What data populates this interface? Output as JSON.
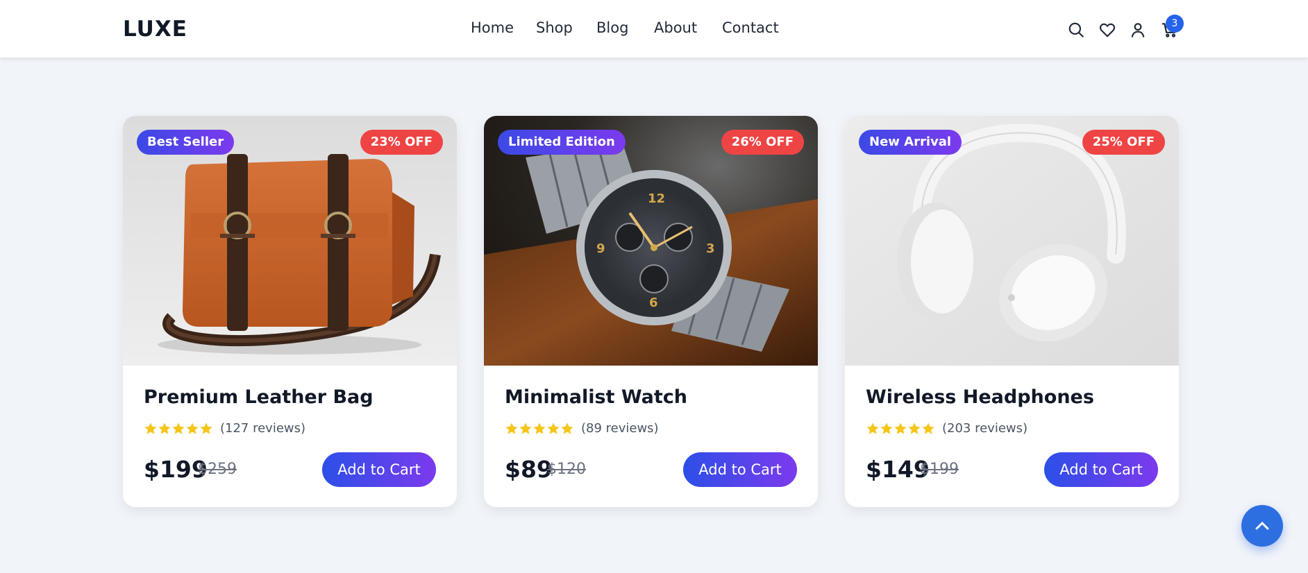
{
  "header": {
    "logo": "LUXE",
    "nav": [
      "Home",
      "Shop",
      "Blog",
      "About",
      "Contact"
    ],
    "cart_count": "3",
    "icons": [
      "search-icon",
      "heart-icon",
      "user-icon",
      "cart-icon"
    ]
  },
  "products": [
    {
      "badge": "Best Seller",
      "discount": "23% OFF",
      "title": "Premium Leather Bag",
      "rating": 5,
      "reviews": "(127 reviews)",
      "price": "$199",
      "old_price": "$259",
      "cta": "Add to Cart"
    },
    {
      "badge": "Limited Edition",
      "discount": "26% OFF",
      "title": "Minimalist Watch",
      "rating": 5,
      "reviews": "(89 reviews)",
      "price": "$89",
      "old_price": "$120",
      "cta": "Add to Cart"
    },
    {
      "badge": "New Arrival",
      "discount": "25% OFF",
      "title": "Wireless Headphones",
      "rating": 5,
      "reviews": "(203 reviews)",
      "price": "$149",
      "old_price": "$199",
      "cta": "Add to Cart"
    }
  ],
  "colors": {
    "accent": "#2563eb",
    "badge_gradient_end": "#7c3aed",
    "discount": "#ef4444",
    "star": "#f5c518",
    "background": "#f1f4f9"
  },
  "back_to_top_icon": "chevron-up-icon"
}
